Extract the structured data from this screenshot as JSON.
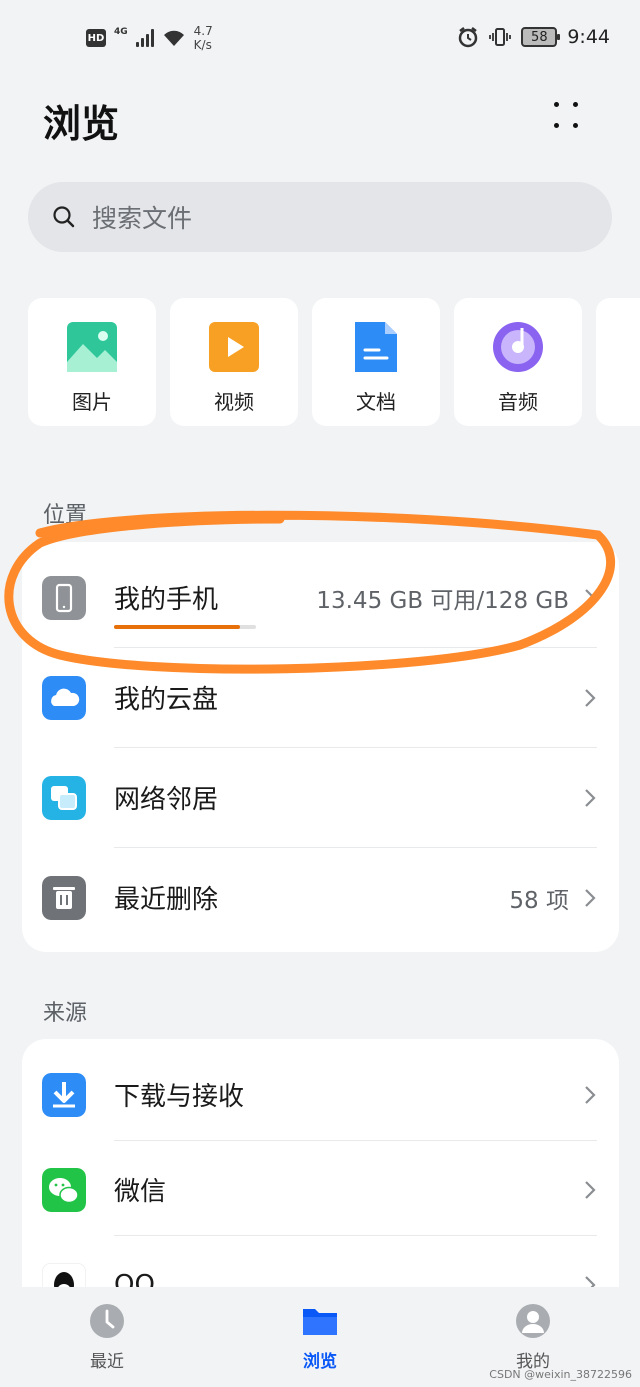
{
  "status_bar": {
    "hd": "HD",
    "net_type": "4G",
    "speed_value": "4.7",
    "speed_unit": "K/s",
    "battery": "58",
    "time": "9:44"
  },
  "header": {
    "title": "浏览"
  },
  "search": {
    "placeholder": "搜索文件"
  },
  "categories": [
    {
      "label": "图片",
      "icon": "image-icon",
      "color": "#2fc79a"
    },
    {
      "label": "视频",
      "icon": "video-icon",
      "color": "#f7a024"
    },
    {
      "label": "文档",
      "icon": "document-icon",
      "color": "#2e8cf6"
    },
    {
      "label": "音频",
      "icon": "audio-icon",
      "color": "#8a63f0"
    }
  ],
  "location": {
    "title": "位置",
    "items": [
      {
        "label": "我的手机",
        "value": "13.45 GB 可用/128 GB",
        "icon": "phone-icon",
        "used_fraction": 0.89
      },
      {
        "label": "我的云盘",
        "value": "",
        "icon": "cloud-icon"
      },
      {
        "label": "网络邻居",
        "value": "",
        "icon": "network-icon"
      },
      {
        "label": "最近删除",
        "value": "58 项",
        "icon": "trash-icon"
      }
    ]
  },
  "source": {
    "title": "来源",
    "items": [
      {
        "label": "下载与接收",
        "icon": "download-icon"
      },
      {
        "label": "微信",
        "icon": "wechat-icon"
      },
      {
        "label": "QQ",
        "icon": "qq-icon"
      }
    ]
  },
  "bottom_nav": [
    {
      "label": "最近",
      "icon": "clock-icon",
      "active": false
    },
    {
      "label": "浏览",
      "icon": "folder-icon",
      "active": true
    },
    {
      "label": "我的",
      "icon": "user-icon",
      "active": false
    }
  ],
  "watermark": "CSDN @weixin_38722596",
  "colors": {
    "accent": "#0a59f7",
    "annotation": "#ff8a2b",
    "storage_bar": "#e8700a"
  }
}
